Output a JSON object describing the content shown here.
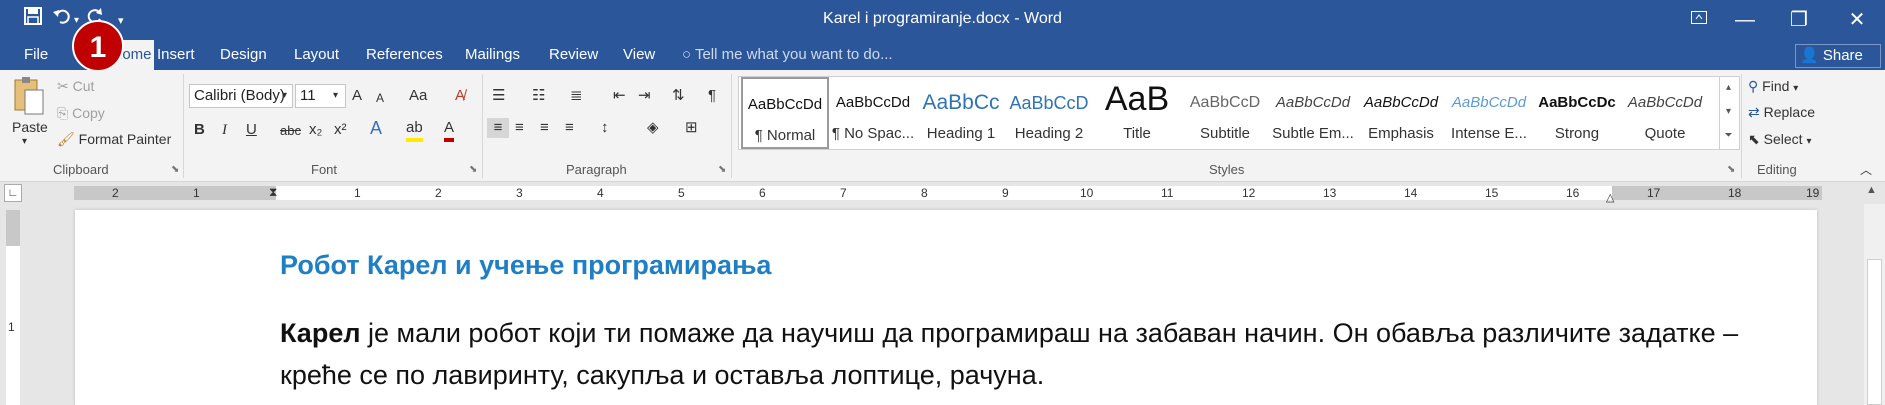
{
  "window": {
    "title": "Karel i programiranje.docx - Word",
    "quick_access": {
      "save_icon": "save-icon",
      "undo_icon": "undo-icon",
      "redo_icon": "redo-icon",
      "customize_icon": "customize-qat-icon"
    },
    "controls": {
      "ribbon_display": "ribbon-display-options-icon",
      "minimize": "—",
      "restore": "❐",
      "close": "✕"
    }
  },
  "annotation": {
    "badge": "1",
    "badge_color": "#c00000"
  },
  "colors": {
    "brand": "#2b579a",
    "heading": "#1f7fc4"
  },
  "tabs": [
    "File",
    "Home",
    "Insert",
    "Design",
    "Layout",
    "References",
    "Mailings",
    "Review",
    "View"
  ],
  "tell_me": "Tell me what you want to do...",
  "share": "Share",
  "clipboard": {
    "paste": "Paste",
    "cut": "Cut",
    "copy": "Copy",
    "format_painter": "Format Painter",
    "label": "Clipboard"
  },
  "font": {
    "name": "Calibri (Body)",
    "size": "11",
    "label": "Font",
    "change_case": "Aa",
    "bold": "B",
    "italic": "I",
    "underline": "U",
    "strike": "abc",
    "subscript": "x₂",
    "superscript": "x²",
    "effects": "A",
    "highlight": "ab",
    "color": "A",
    "grow": "A",
    "shrink": "A"
  },
  "paragraph": {
    "label": "Paragraph",
    "show_marks": "¶"
  },
  "styles": {
    "label": "Styles",
    "items": [
      {
        "sample": "AaBbCcDd",
        "name": "¶ Normal"
      },
      {
        "sample": "AaBbCcDd",
        "name": "¶ No Spac..."
      },
      {
        "sample": "AaBbCc",
        "name": "Heading 1"
      },
      {
        "sample": "AaBbCcD",
        "name": "Heading 2"
      },
      {
        "sample": "AaB",
        "name": "Title"
      },
      {
        "sample": "AaBbCcD",
        "name": "Subtitle"
      },
      {
        "sample": "AaBbCcDd",
        "name": "Subtle Em..."
      },
      {
        "sample": "AaBbCcDd",
        "name": "Emphasis"
      },
      {
        "sample": "AaBbCcDd",
        "name": "Intense E..."
      },
      {
        "sample": "AaBbCcDc",
        "name": "Strong"
      },
      {
        "sample": "AaBbCcDd",
        "name": "Quote"
      }
    ]
  },
  "editing": {
    "label": "Editing",
    "find": "Find",
    "replace": "Replace",
    "select": "Select"
  },
  "ruler": {
    "left_numbers": [
      "2",
      "1"
    ],
    "numbers": [
      "1",
      "2",
      "3",
      "4",
      "5",
      "6",
      "7",
      "8",
      "9",
      "10",
      "11",
      "12",
      "13",
      "14",
      "15",
      "16",
      "17",
      "18",
      "19"
    ]
  },
  "vruler": {
    "numbers": [
      "1"
    ]
  },
  "document": {
    "heading": "Робот Карел и учење програмирања",
    "para_bold": "Карел",
    "para_rest": " је мали робот који ти помаже да научиш да програмираш на забаван начин. Он обавља различите задатке – креће се по лавиринту, сакупља и оставља лоптице, рачуна."
  }
}
